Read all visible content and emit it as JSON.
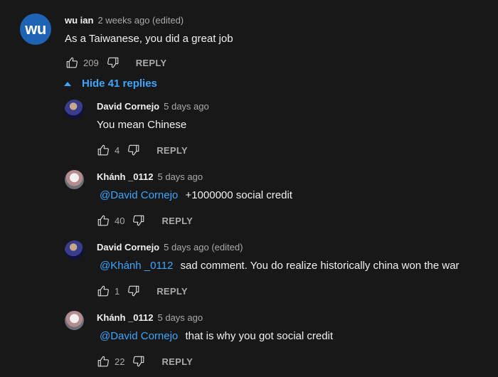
{
  "top_comment": {
    "avatar_initials": "wu",
    "author": "wu ian",
    "meta": "2 weeks ago (edited)",
    "text": "As a Taiwanese, you did a great job",
    "likes": "209",
    "reply_label": "REPLY"
  },
  "replies_toggle": {
    "label": "Hide 41 replies"
  },
  "replies": [
    {
      "author": "David Cornejo",
      "meta": "5 days ago",
      "mention": "",
      "text": "You mean Chinese",
      "likes": "4",
      "reply_label": "REPLY"
    },
    {
      "author": "Khánh _0112",
      "meta": "5 days ago",
      "mention": "@David Cornejo",
      "text": "+1000000 social credit",
      "likes": "40",
      "reply_label": "REPLY"
    },
    {
      "author": "David Cornejo",
      "meta": "5 days ago (edited)",
      "mention": "@Khánh _0112",
      "text": "sad comment. You do realize historically china won the war",
      "likes": "1",
      "reply_label": "REPLY"
    },
    {
      "author": "Khánh _0112",
      "meta": "5 days ago",
      "mention": "@David Cornejo",
      "text": "that is why you got social credit",
      "likes": "22",
      "reply_label": "REPLY"
    }
  ],
  "colors": {
    "background": "#181818",
    "link": "#3ea6ff",
    "avatar_top": "#1f64b4"
  },
  "icons": {
    "like": "thumb-up-outline",
    "dislike": "thumb-down-outline",
    "toggle": "caret-up"
  }
}
